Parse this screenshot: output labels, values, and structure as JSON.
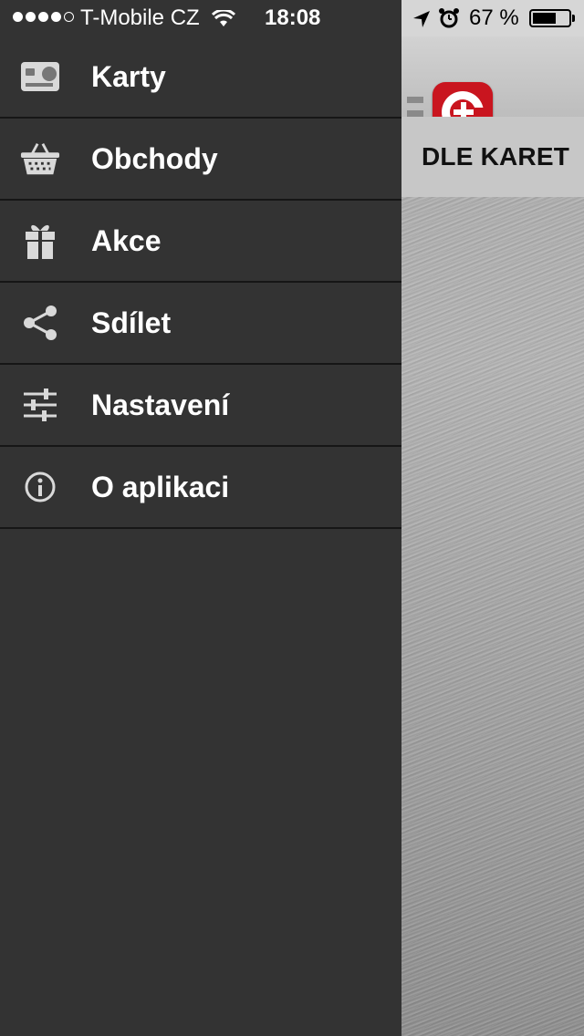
{
  "status_bar": {
    "carrier": "T-Mobile CZ",
    "time": "18:08",
    "battery": "67 %",
    "signal_bars": 4,
    "signal_total": 5,
    "battery_level": 0.67
  },
  "menu": {
    "items": [
      {
        "label": "Karty",
        "icon": "card-icon"
      },
      {
        "label": "Obchody",
        "icon": "basket-icon"
      },
      {
        "label": "Akce",
        "icon": "gift-icon"
      },
      {
        "label": "Sdílet",
        "icon": "share-icon"
      },
      {
        "label": "Nastavení",
        "icon": "sliders-icon"
      },
      {
        "label": "O aplikaci",
        "icon": "info-icon"
      }
    ]
  },
  "main": {
    "filter_label": "DLE KARET",
    "logo_icon": "app-logo-icon",
    "logo_color": "#c9151f"
  },
  "colors": {
    "drawer_bg": "#333333",
    "divider": "#161616"
  }
}
